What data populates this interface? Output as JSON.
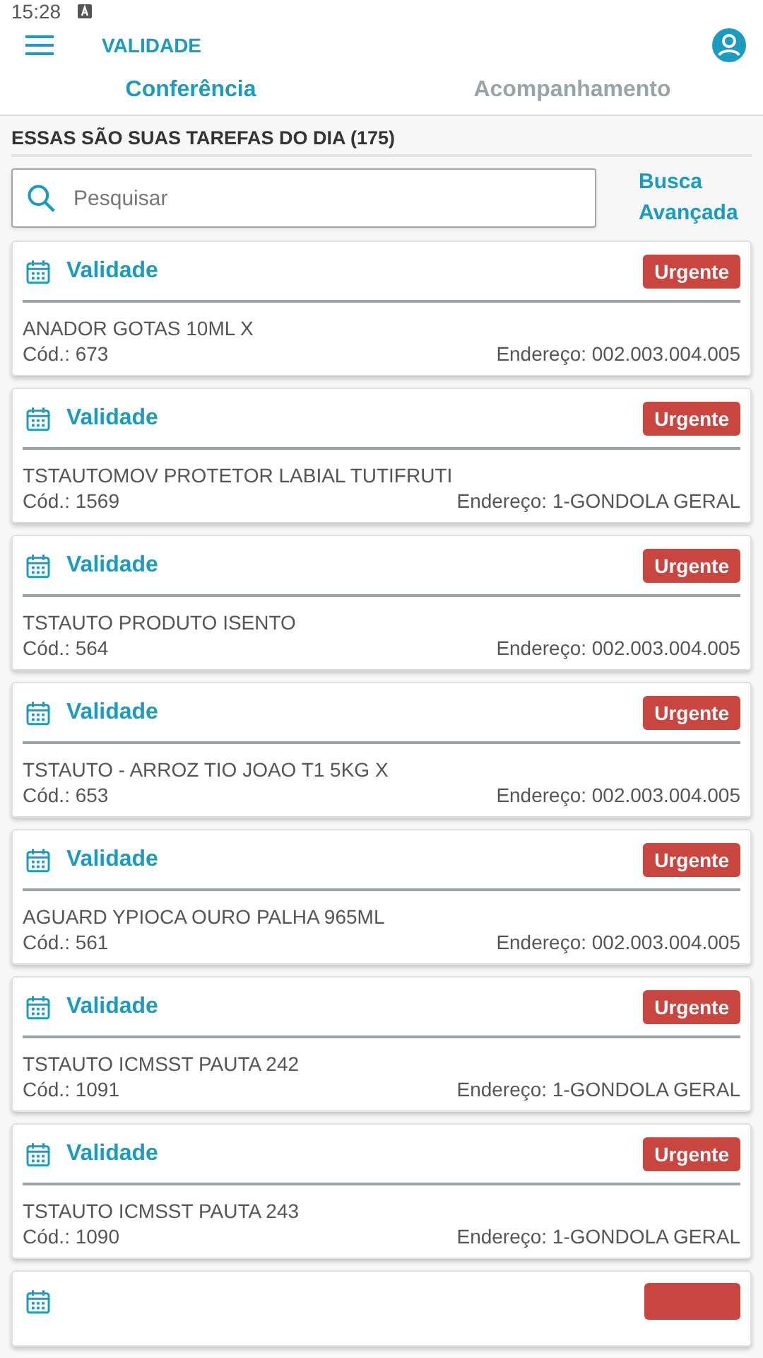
{
  "status_bar": {
    "time": "15:28"
  },
  "app_bar": {
    "title": "VALIDADE"
  },
  "tabs": [
    {
      "label": "Conferência",
      "selected": true
    },
    {
      "label": "Acompanhamento",
      "selected": false
    }
  ],
  "section_title": "ESSAS SÃO SUAS TAREFAS DO DIA (175)",
  "search": {
    "placeholder": "Pesquisar"
  },
  "advanced_search": "Busca Avançada",
  "tasks": [
    {
      "kind": "full",
      "title": "Validade",
      "badge": "Urgente",
      "product": "ANADOR GOTAS 10ML X",
      "code": "Cód.: 673",
      "address": "Endereço: 002.003.004.005"
    },
    {
      "kind": "full",
      "title": "Validade",
      "badge": "Urgente",
      "product": "TSTAUTOMOV PROTETOR LABIAL TUTIFRUTI",
      "code": "Cód.: 1569",
      "address": "Endereço: 1-GONDOLA GERAL"
    },
    {
      "kind": "full",
      "title": "Validade",
      "badge": "Urgente",
      "product": "TSTAUTO PRODUTO ISENTO",
      "code": "Cód.: 564",
      "address": "Endereço: 002.003.004.005"
    },
    {
      "kind": "full",
      "title": "Validade",
      "badge": "Urgente",
      "product": "TSTAUTO - ARROZ TIO JOAO T1 5KG X",
      "code": "Cód.: 653",
      "address": "Endereço: 002.003.004.005"
    },
    {
      "kind": "full",
      "title": "Validade",
      "badge": "Urgente",
      "product": "AGUARD YPIOCA OURO PALHA 965ML",
      "code": "Cód.: 561",
      "address": "Endereço: 002.003.004.005"
    },
    {
      "kind": "full",
      "title": "Validade",
      "badge": "Urgente",
      "product": "TSTAUTO ICMSST PAUTA 242",
      "code": "Cód.: 1091",
      "address": "Endereço: 1-GONDOLA GERAL"
    },
    {
      "kind": "full",
      "title": "Validade",
      "badge": "Urgente",
      "product": "TSTAUTO ICMSST PAUTA 243",
      "code": "Cód.: 1090",
      "address": "Endereço: 1-GONDOLA GERAL"
    },
    {
      "kind": "partial"
    }
  ]
}
